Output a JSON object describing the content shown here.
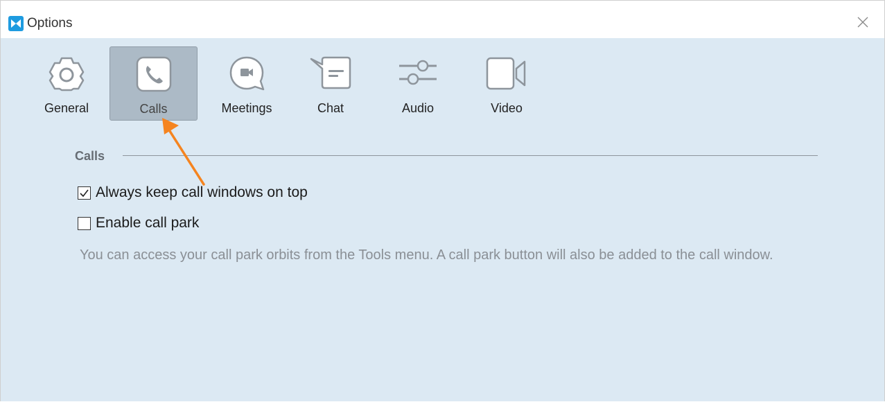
{
  "window": {
    "title": "Options",
    "logo_icon": "app-logo-icon",
    "close_icon": "close-icon"
  },
  "tabs": [
    {
      "label": "General",
      "icon": "gear-icon",
      "selected": false
    },
    {
      "label": "Calls",
      "icon": "phone-icon",
      "selected": true
    },
    {
      "label": "Meetings",
      "icon": "video-bubble-icon",
      "selected": false
    },
    {
      "label": "Chat",
      "icon": "chat-bubble-icon",
      "selected": false
    },
    {
      "label": "Audio",
      "icon": "sliders-icon",
      "selected": false
    },
    {
      "label": "Video",
      "icon": "camera-icon",
      "selected": false
    }
  ],
  "calls_section": {
    "title": "Calls",
    "options": [
      {
        "label": "Always keep call windows on top",
        "checked": true
      },
      {
        "label": "Enable call park",
        "checked": false
      }
    ],
    "help_text": "You can access your call park orbits from the Tools menu. A call park button will also be added to the call window."
  },
  "colors": {
    "content_background": "#dce9f3",
    "selected_tab": "#acbac6",
    "annotation_arrow": "#f5841f",
    "logo": "#1e9be0"
  }
}
